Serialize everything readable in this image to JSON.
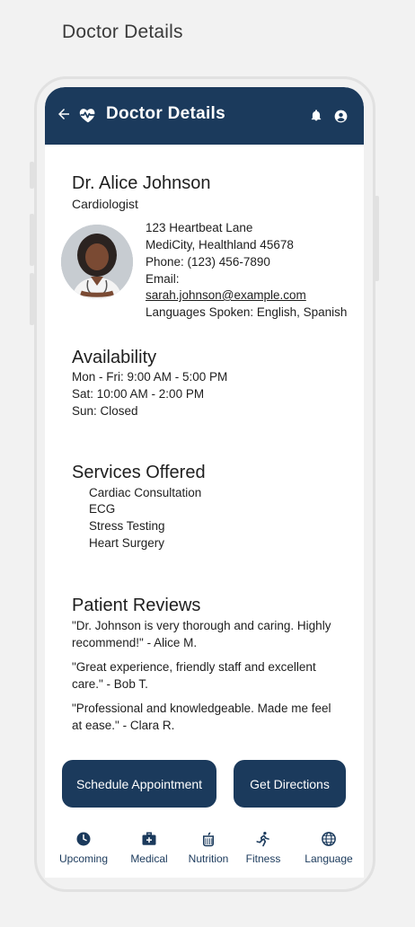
{
  "caption": "Doctor Details",
  "appbar": {
    "title": "Doctor Details",
    "back_icon": "arrow-left-icon",
    "logo_icon": "heartbeat-icon",
    "notification_icon": "bell-icon",
    "profile_icon": "user-circle-icon"
  },
  "doctor": {
    "name": "Dr. Alice Johnson",
    "specialty": "Cardiologist",
    "address_line1": "123 Heartbeat Lane",
    "address_line2": "MediCity, Healthland 45678",
    "phone": "Phone: (123) 456-7890",
    "email_label": "Email:",
    "email": "sarah.johnson@example.com",
    "languages": "Languages Spoken: English, Spanish"
  },
  "availability": {
    "title": "Availability",
    "lines": [
      "Mon - Fri: 9:00 AM - 5:00 PM",
      "Sat: 10:00 AM - 2:00 PM",
      "Sun: Closed"
    ]
  },
  "services": {
    "title": "Services Offered",
    "items": [
      "Cardiac Consultation",
      "ECG",
      "Stress Testing",
      "Heart Surgery"
    ]
  },
  "reviews": {
    "title": "Patient Reviews",
    "items": [
      "\"Dr. Johnson is very thorough and caring. Highly recommend!\" - Alice M.",
      "\"Great experience, friendly staff and excellent care.\" - Bob T.",
      "\"Professional and knowledgeable. Made me feel at ease.\" - Clara R."
    ]
  },
  "actions": {
    "schedule": "Schedule Appointment",
    "directions": "Get Directions"
  },
  "nav": [
    {
      "label": "Upcoming",
      "icon": "clock-icon"
    },
    {
      "label": "Medical",
      "icon": "medical-kit-icon"
    },
    {
      "label": "Nutrition",
      "icon": "nutrition-icon"
    },
    {
      "label": "Fitness",
      "icon": "running-icon"
    },
    {
      "label": "Language",
      "icon": "globe-icon"
    }
  ],
  "colors": {
    "primary": "#1b3a5c",
    "background": "#f2f2f2",
    "surface": "#ffffff"
  }
}
